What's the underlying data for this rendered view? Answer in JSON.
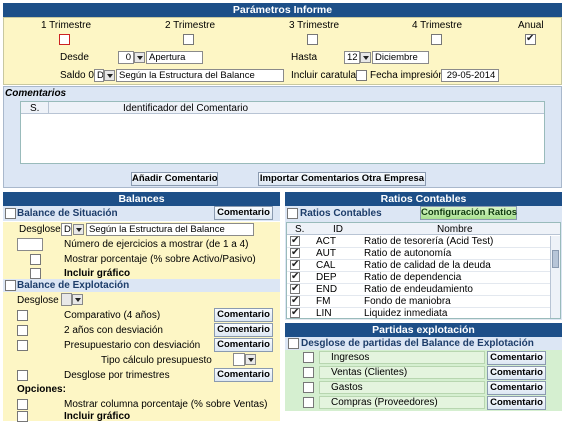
{
  "params": {
    "title": "Parámetros Informe",
    "periods": [
      {
        "label": "1 Trimestre",
        "checked": false
      },
      {
        "label": "2 Trimestre",
        "checked": false
      },
      {
        "label": "3 Trimestre",
        "checked": false
      },
      {
        "label": "4 Trimestre",
        "checked": false
      },
      {
        "label": "Anual",
        "checked": true
      }
    ],
    "desde_label": "Desde",
    "desde_value": "0",
    "desde_text": "Apertura",
    "hasta_label": "Hasta",
    "hasta_value": "12",
    "hasta_text": "Diciembre",
    "saldo_label": "Saldo 0",
    "saldo_value": "D",
    "saldo_text": "Según la Estructura del Balance",
    "caratula_label": "Incluir caratula",
    "fecha_label": "Fecha impresión",
    "fecha_value": "29-05-2014"
  },
  "comentarios": {
    "title": "Comentarios",
    "col_s": "S.",
    "col_id": "Identificador del Comentario",
    "add_button": "Añadir Comentario",
    "import_button": "Importar Comentarios Otra Empresa"
  },
  "balances": {
    "title": "Balances",
    "situacion_label": "Balance de Situación",
    "comentario_btn": "Comentario",
    "desglose_label": "Desglose",
    "desglose_value": "D",
    "desglose_text": "Según la Estructura del Balance",
    "ejercicios_label": "Número de ejercicios a mostrar (de 1 a 4)",
    "porcentaje_label": "Mostrar porcentaje (% sobre Activo/Pasivo)",
    "grafico_label": "Incluir gráfico",
    "explotacion_label": "Balance de Explotación",
    "desglose2_label": "Desglose",
    "comparativo_label": "Comparativo (4 años)",
    "dos_anos_label": "2 años con desviación",
    "presupuestario_label": "Presupuestario con desviación",
    "tipo_calculo_label": "Tipo cálculo presupuesto",
    "trimestres_label": "Desglose por trimestres",
    "opciones_label": "Opciones:",
    "columna_label": "Mostrar columna porcentaje (% sobre Ventas)",
    "grafico2_label": "Incluir gráfico"
  },
  "ratios": {
    "title": "Ratios Contables",
    "section_label": "Ratios Contables",
    "config_button": "Configuración Ratios",
    "col_s": "S.",
    "col_id": "ID",
    "col_nombre": "Nombre",
    "rows": [
      {
        "id": "ACT",
        "nombre": "Ratio de tesorería (Acid Test)",
        "checked": true
      },
      {
        "id": "AUT",
        "nombre": "Ratio de autonomía",
        "checked": true
      },
      {
        "id": "CAL",
        "nombre": "Ratio de calidad de la deuda",
        "checked": true
      },
      {
        "id": "DEP",
        "nombre": "Ratio de dependencia",
        "checked": true
      },
      {
        "id": "END",
        "nombre": "Ratio de endeudamiento",
        "checked": true
      },
      {
        "id": "FM",
        "nombre": "Fondo de maniobra",
        "checked": true
      },
      {
        "id": "LIN",
        "nombre": "Liquidez inmediata",
        "checked": true
      }
    ]
  },
  "partidas": {
    "title": "Partidas explotación",
    "section_label": "Desglose de partidas del Balance de Explotación",
    "comentario_btn": "Comentario",
    "rows": [
      {
        "label": "Ingresos"
      },
      {
        "label": "Ventas (Clientes)"
      },
      {
        "label": "Gastos"
      },
      {
        "label": "Compras (Proveedores)"
      }
    ]
  },
  "colors": {
    "header_blue": "#1d4f88",
    "panel_blue": "#dce6f4",
    "panel_yellow": "#fdf6c5",
    "panel_green": "#d5efd0"
  }
}
